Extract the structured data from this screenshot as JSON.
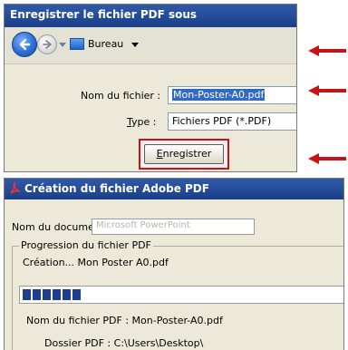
{
  "save_dialog": {
    "title": "Enregistrer le fichier PDF sous",
    "location": "Bureau",
    "filename_label": "Nom du fichier :",
    "filename_value": "Mon-Poster-A0.pdf",
    "type_label_underlined": "T",
    "type_label_rest": "ype :",
    "type_value": "Fichiers PDF (*.PDF)",
    "save_button_underlined": "E",
    "save_button_rest": "nregistrer"
  },
  "creation_dialog": {
    "title": "Création du fichier Adobe PDF",
    "document_name_label": "Nom du document :",
    "document_name_value": "Microsoft PowerPoint",
    "progress_group_label": "Progression du fichier PDF",
    "creation_status": "Création...  Mon Poster A0.pdf",
    "progress_blocks": 6,
    "pdf_filename_line": "Nom du fichier PDF : Mon-Poster-A0.pdf",
    "folder_line": "Dossier PDF : C:\\Users\\Desktop\\"
  },
  "colors": {
    "titlebar": "#1c3f87",
    "annotation_red": "#c3141a",
    "progress_fill": "#1c3f8f"
  },
  "icons": [
    "back-arrow-icon",
    "forward-arrow-icon",
    "desktop-icon",
    "adobe-pdf-icon",
    "red-pointer-arrow-icon"
  ]
}
